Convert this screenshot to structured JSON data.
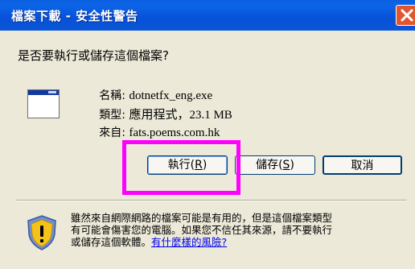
{
  "window": {
    "title": "檔案下載 - 安全性警告"
  },
  "question": "是否要執行或儲存這個檔案?",
  "file": {
    "icon": "application-window-icon",
    "name_label": "名稱:",
    "name_value": "dotnetfx_eng.exe",
    "type_label": "類型:",
    "type_value": "應用程式，23.1 MB",
    "from_label": "來自:",
    "from_value": "fats.poems.com.hk"
  },
  "buttons": {
    "run": {
      "text": "執行",
      "key": "R"
    },
    "save": {
      "text": "儲存",
      "key": "S"
    },
    "cancel": {
      "label": "取消"
    }
  },
  "warning": {
    "line1": "雖然來自網際網路的檔案可能是有用的，但是這個檔案類型",
    "line2": "有可能會傷害您的電腦。如果您不信任其來源，請不要執行",
    "line3": "或儲存這個軟體。",
    "link": "有什麼樣的風險?"
  },
  "colors": {
    "title_bar": "#0b56d6",
    "highlight": "#ff00ff",
    "close": "#e2562f"
  }
}
